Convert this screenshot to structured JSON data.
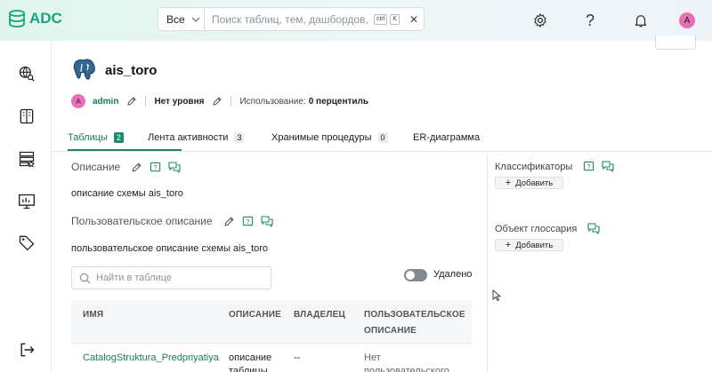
{
  "app": {
    "logo_text": "ADC",
    "accent": "#1a8a69",
    "avatar_letter": "A",
    "avatar_color": "#e86fb8"
  },
  "search": {
    "scope": "Все",
    "placeholder": "Поиск таблиц, тем, дашбордов, ...",
    "shortcut_1": "ctrl",
    "shortcut_2": "K",
    "clear_label": "✕"
  },
  "topbar_icons": [
    "gear-icon",
    "help-icon",
    "bell-icon"
  ],
  "help_label": "?",
  "sidebar_icons": [
    "globe-search-icon",
    "book-icon",
    "server-list-icon",
    "monitor-chart-icon",
    "tag-icon",
    "logout-icon"
  ],
  "schema": {
    "name": "ais_toro",
    "icon": "postgresql-elephant-icon"
  },
  "meta": {
    "owner_avatar": "A",
    "owner": "admin",
    "level": "Нет уровня",
    "usage_label": "Использование:",
    "usage_value": "0 перцентиль"
  },
  "tabs": [
    {
      "label": "Таблицы",
      "count": "2",
      "active": true
    },
    {
      "label": "Лента активности",
      "count": "3",
      "active": false
    },
    {
      "label": "Хранимые процедуры",
      "count": "0",
      "active": false
    },
    {
      "label": "ER-диаграмма",
      "count": "",
      "active": false
    }
  ],
  "description": {
    "heading": "Описание",
    "text": "описание схемы ais_toro"
  },
  "user_description": {
    "heading": "Пользовательское описание",
    "text": "пользовательское описание схемы ais_toro"
  },
  "table_search": {
    "placeholder": "Найти в таблице"
  },
  "deleted_toggle": {
    "label": "Удалено",
    "on": false
  },
  "table": {
    "columns": [
      "ИМЯ",
      "ОПИСАНИЕ",
      "ВЛАДЕЛЕЦ",
      "ПОЛЬЗОВАТЕЛЬСКОЕ ОПИСАНИЕ"
    ],
    "rows": [
      {
        "name": "CatalogStruktura_Predpriyatiya",
        "description": "описание таблицы",
        "owner": "--",
        "user_description": "Нет пользовательского"
      }
    ]
  },
  "right_panel": {
    "classifiers": {
      "heading": "Классификаторы",
      "add_label": "Добавить"
    },
    "glossary": {
      "heading": "Объект глоссария",
      "add_label": "Добавить"
    }
  }
}
